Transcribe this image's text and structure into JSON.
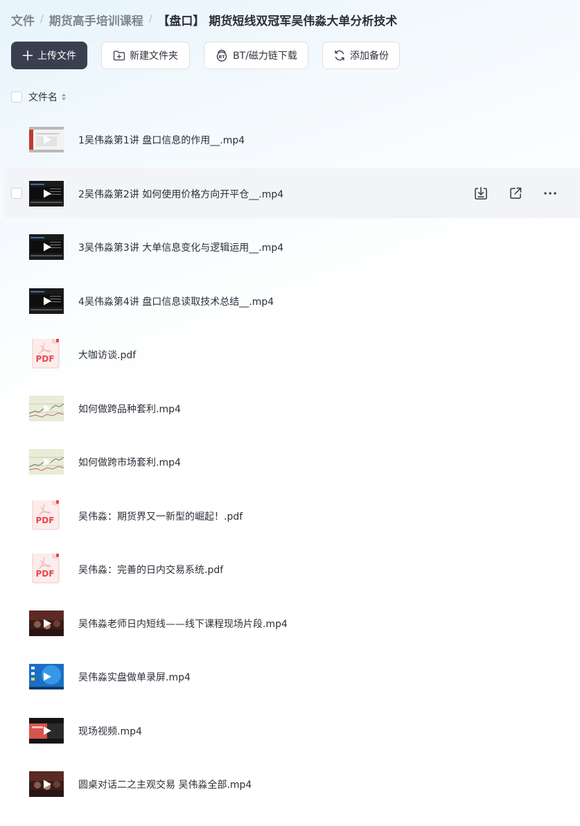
{
  "breadcrumb": {
    "items": [
      "文件",
      "期货高手培训课程"
    ],
    "current": "【盘口】 期货短线双冠军吴伟淼大单分析技术",
    "separator": "/"
  },
  "toolbar": {
    "upload_label": "上传文件",
    "new_folder_label": "新建文件夹",
    "bt_label": "BT/磁力链下载",
    "backup_label": "添加备份"
  },
  "list_header": {
    "name_label": "文件名"
  },
  "files": [
    {
      "name": "1吴伟淼第1讲 盘口信息的作用__.mp4",
      "kind": "video",
      "thumb": "screen-light"
    },
    {
      "name": "2吴伟淼第2讲 如何使用价格方向开平仓__.mp4",
      "kind": "video",
      "thumb": "screen-dark"
    },
    {
      "name": "3吴伟淼第3讲 大单信息变化与逻辑运用__.mp4",
      "kind": "video",
      "thumb": "screen-dark"
    },
    {
      "name": "4吴伟淼第4讲 盘口信息读取技术总结__.mp4",
      "kind": "video",
      "thumb": "screen-dark"
    },
    {
      "name": "大咖访谈.pdf",
      "kind": "pdf"
    },
    {
      "name": "如何做跨品种套利.mp4",
      "kind": "video",
      "thumb": "chart"
    },
    {
      "name": "如何做跨市场套利.mp4",
      "kind": "video",
      "thumb": "chart"
    },
    {
      "name": "吴伟淼：期货界又一新型的崛起！.pdf",
      "kind": "pdf"
    },
    {
      "name": "吴伟淼：完善的日内交易系统.pdf",
      "kind": "pdf"
    },
    {
      "name": "吴伟淼老师日内短线——线下课程现场片段.mp4",
      "kind": "video",
      "thumb": "room"
    },
    {
      "name": "吴伟淼实盘做单录屏.mp4",
      "kind": "video",
      "thumb": "desktop"
    },
    {
      "name": "现场视频.mp4",
      "kind": "video",
      "thumb": "stage"
    },
    {
      "name": "圆桌对话二之主观交易 吴伟淼全部.mp4",
      "kind": "video",
      "thumb": "room"
    }
  ],
  "hovered_row": 1,
  "pdf_badge": "PDF",
  "icons": {
    "upload": "plus-icon",
    "new_folder": "folder-plus-icon",
    "bt": "bt-icon",
    "backup": "backup-sync-icon",
    "sort": "sort-icon",
    "download": "download-icon",
    "share": "share-external-icon",
    "more": "more-dots-icon"
  },
  "colors": {
    "primary_button": "#3a3f4f",
    "pdf_red": "#e5484d",
    "hover_row": "#f3f4f7"
  }
}
